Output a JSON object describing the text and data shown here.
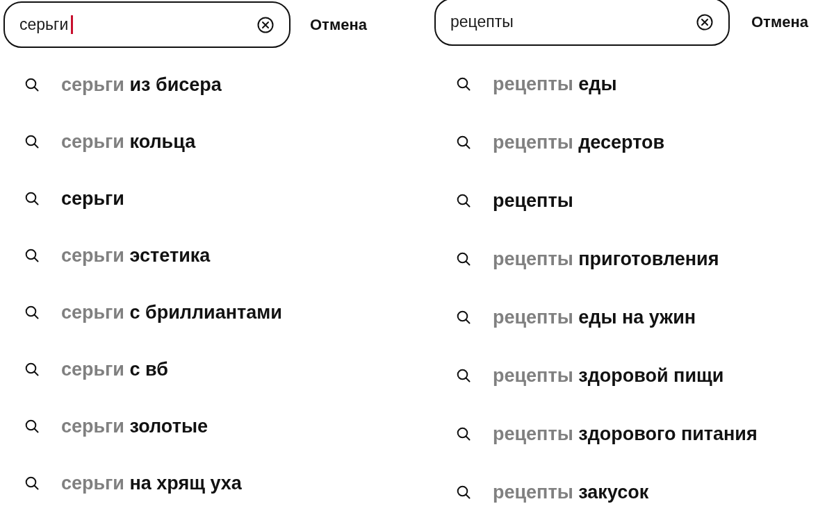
{
  "panels": [
    {
      "search": {
        "value": "серьги",
        "focused": true
      },
      "cancel": "Отмена",
      "suggestions": [
        {
          "parts": [
            {
              "text": "серьги",
              "muted": true
            },
            {
              "text": "из бисера",
              "muted": false
            }
          ]
        },
        {
          "parts": [
            {
              "text": "серьги",
              "muted": true
            },
            {
              "text": "кольца",
              "muted": false
            }
          ]
        },
        {
          "parts": [
            {
              "text": "серьги",
              "muted": false
            }
          ]
        },
        {
          "parts": [
            {
              "text": "серьги",
              "muted": true
            },
            {
              "text": "эстетика",
              "muted": false
            }
          ]
        },
        {
          "parts": [
            {
              "text": "серьги",
              "muted": true
            },
            {
              "text": "с бриллиантами",
              "muted": false
            }
          ]
        },
        {
          "parts": [
            {
              "text": "серьги",
              "muted": true
            },
            {
              "text": "с вб",
              "muted": false
            }
          ]
        },
        {
          "parts": [
            {
              "text": "серьги",
              "muted": true
            },
            {
              "text": "золотые",
              "muted": false
            }
          ]
        },
        {
          "parts": [
            {
              "text": "серьги",
              "muted": true
            },
            {
              "text": "на хрящ уха",
              "muted": false
            }
          ]
        }
      ]
    },
    {
      "search": {
        "value": "рецепты",
        "focused": false
      },
      "cancel": "Отмена",
      "suggestions": [
        {
          "parts": [
            {
              "text": "рецепты",
              "muted": true
            },
            {
              "text": "еды",
              "muted": false
            }
          ]
        },
        {
          "parts": [
            {
              "text": "рецепты",
              "muted": true
            },
            {
              "text": "десертов",
              "muted": false
            }
          ]
        },
        {
          "parts": [
            {
              "text": "рецепты",
              "muted": false
            }
          ]
        },
        {
          "parts": [
            {
              "text": "рецепты",
              "muted": true
            },
            {
              "text": "приготовления",
              "muted": false
            }
          ]
        },
        {
          "parts": [
            {
              "text": "рецепты",
              "muted": true
            },
            {
              "text": "еды на ужин",
              "muted": false
            }
          ]
        },
        {
          "parts": [
            {
              "text": "рецепты",
              "muted": true
            },
            {
              "text": "здоровой пищи",
              "muted": false
            }
          ]
        },
        {
          "parts": [
            {
              "text": "рецепты",
              "muted": true
            },
            {
              "text": "здорового питания",
              "muted": false
            }
          ]
        },
        {
          "parts": [
            {
              "text": "рецепты",
              "muted": true
            },
            {
              "text": "закусок",
              "muted": false
            }
          ]
        }
      ]
    }
  ]
}
